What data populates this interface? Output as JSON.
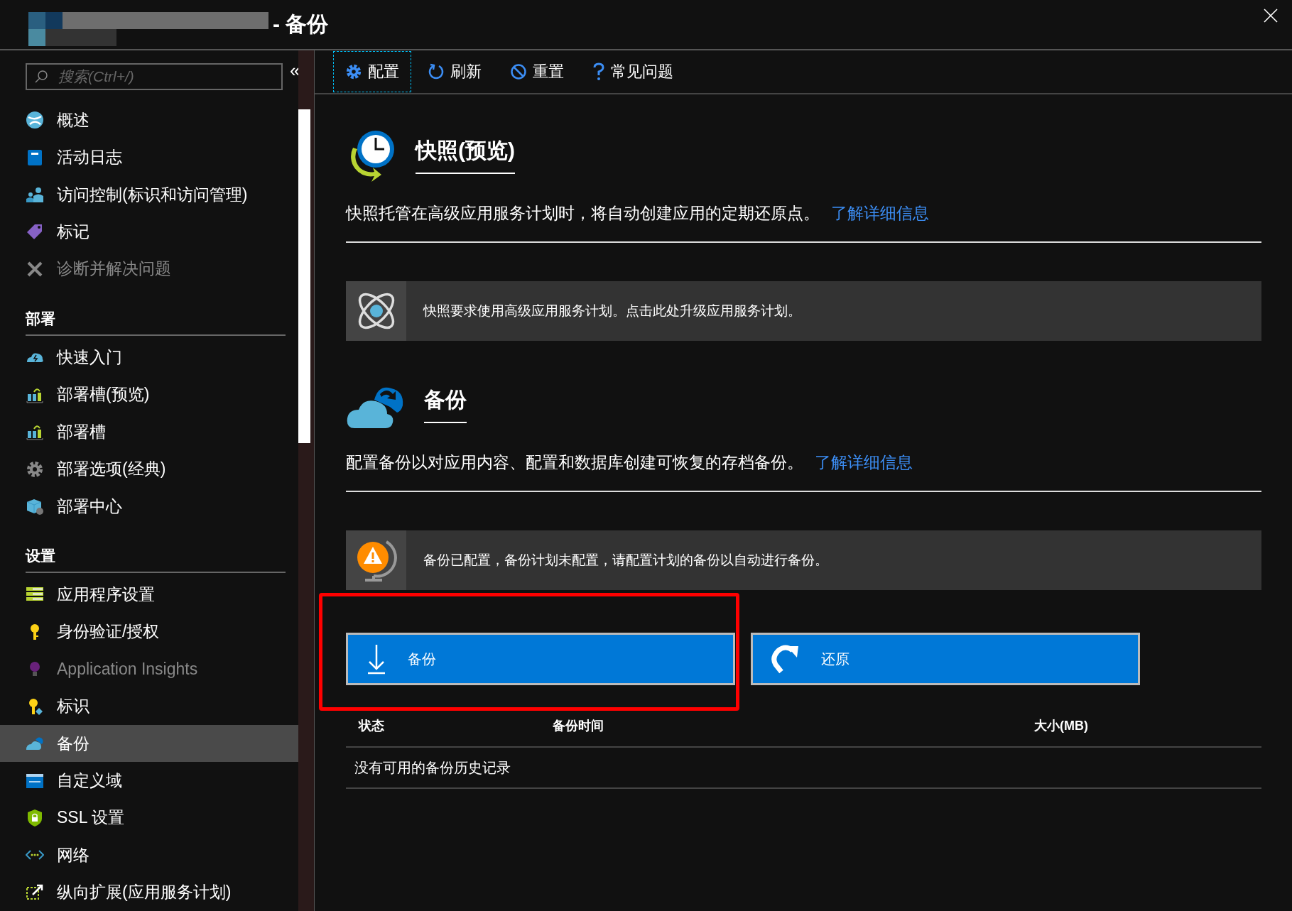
{
  "window": {
    "title": "- 备份"
  },
  "sidebar": {
    "search": {
      "placeholder": "搜索(Ctrl+/)"
    },
    "collapse": "«",
    "groups": [
      {
        "items": [
          {
            "label": "概述",
            "disabled": false,
            "selected": false
          },
          {
            "label": "活动日志",
            "disabled": false,
            "selected": false
          },
          {
            "label": "访问控制(标识和访问管理)",
            "disabled": false,
            "selected": false
          },
          {
            "label": "标记",
            "disabled": false,
            "selected": false
          },
          {
            "label": "诊断并解决问题",
            "disabled": true,
            "selected": false
          }
        ]
      },
      {
        "heading": "部署",
        "items": [
          {
            "label": "快速入门",
            "disabled": false,
            "selected": false
          },
          {
            "label": "部署槽(预览)",
            "disabled": false,
            "selected": false
          },
          {
            "label": "部署槽",
            "disabled": false,
            "selected": false
          },
          {
            "label": "部署选项(经典)",
            "disabled": false,
            "selected": false
          },
          {
            "label": "部署中心",
            "disabled": false,
            "selected": false
          }
        ]
      },
      {
        "heading": "设置",
        "items": [
          {
            "label": "应用程序设置",
            "disabled": false,
            "selected": false
          },
          {
            "label": "身份验证/授权",
            "disabled": false,
            "selected": false
          },
          {
            "label": "Application Insights",
            "disabled": true,
            "selected": false
          },
          {
            "label": "标识",
            "disabled": false,
            "selected": false
          },
          {
            "label": "备份",
            "disabled": false,
            "selected": true
          },
          {
            "label": "自定义域",
            "disabled": false,
            "selected": false
          },
          {
            "label": "SSL 设置",
            "disabled": false,
            "selected": false
          },
          {
            "label": "网络",
            "disabled": false,
            "selected": false
          },
          {
            "label": "纵向扩展(应用服务计划)",
            "disabled": false,
            "selected": false
          }
        ]
      }
    ]
  },
  "toolbar": [
    {
      "label": "配置",
      "selected": true
    },
    {
      "label": "刷新",
      "selected": false
    },
    {
      "label": "重置",
      "selected": false
    },
    {
      "label": "常见问题",
      "selected": false
    }
  ],
  "sections": [
    {
      "title": "快照(预览)",
      "description": "快照托管在高级应用服务计划时，将自动创建应用的定期还原点。",
      "link": "了解详细信息",
      "notice": "快照要求使用高级应用服务计划。点击此处升级应用服务计划。"
    },
    {
      "title": "备份",
      "description": "配置备份以对应用内容、配置和数据库创建可恢复的存档备份。",
      "link": "了解详细信息",
      "notice": "备份已配置，备份计划未配置，请配置计划的备份以自动进行备份。"
    }
  ],
  "actions": [
    {
      "label": "备份"
    },
    {
      "label": "还原"
    }
  ],
  "table": {
    "columns": [
      "状态",
      "备份时间",
      "大小(MB)"
    ],
    "empty": "没有可用的备份历史记录"
  }
}
